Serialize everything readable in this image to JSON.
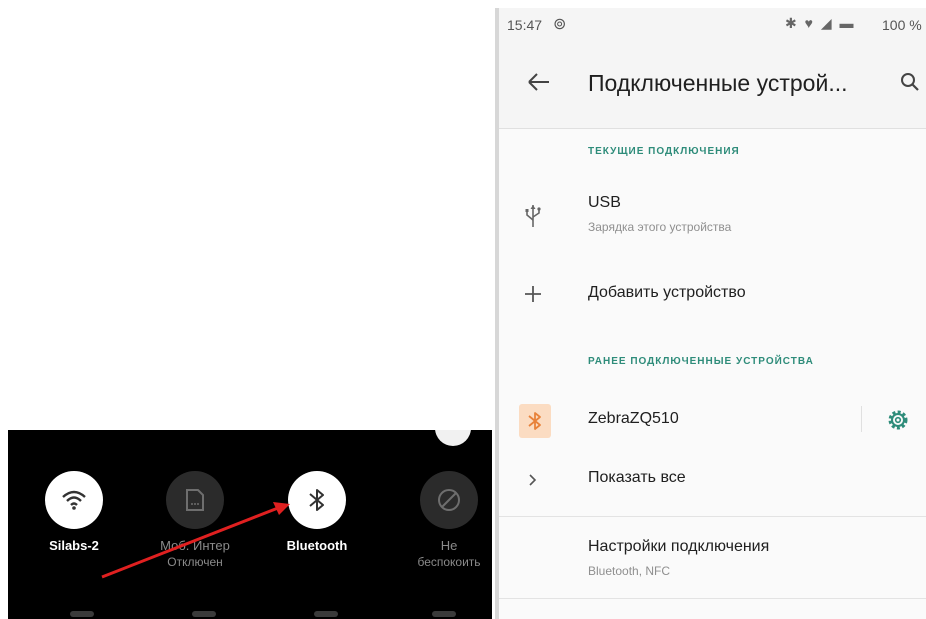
{
  "quick_settings": {
    "tiles": [
      {
        "label": "Silabs-2",
        "sublabel": "",
        "state": "on",
        "icon": "wifi-icon"
      },
      {
        "label": "Моб. Интер",
        "sublabel": "Отключен",
        "state": "off",
        "icon": "sim-card-icon"
      },
      {
        "label": "Bluetooth",
        "sublabel": "",
        "state": "on",
        "icon": "bluetooth-icon"
      },
      {
        "label": "Не",
        "sublabel": "беспокоить",
        "state": "off",
        "icon": "do-not-disturb-icon"
      }
    ],
    "annotation_arrow_color": "#e02020"
  },
  "settings": {
    "status_bar": {
      "time": "15:47",
      "battery": "100 %"
    },
    "app_bar": {
      "title": "Подключенные устрой..."
    },
    "sections": {
      "current": "ТЕКУЩИЕ ПОДКЛЮЧЕНИЯ",
      "previous": "РАНЕЕ ПОДКЛЮЧЕННЫЕ УСТРОЙСТВА"
    },
    "usb": {
      "title": "USB",
      "subtitle": "Зарядка этого устройства"
    },
    "add_device": {
      "title": "Добавить устройство"
    },
    "device": {
      "name": "ZebraZQ510"
    },
    "show_all": {
      "title": "Показать все"
    },
    "connection_settings": {
      "title": "Настройки подключения",
      "subtitle": "Bluetooth, NFC"
    },
    "colors": {
      "accent": "#2e8c7a",
      "bluetooth_icon_bg": "#fbdcc2",
      "bluetooth_icon_fg": "#e8823a"
    }
  }
}
